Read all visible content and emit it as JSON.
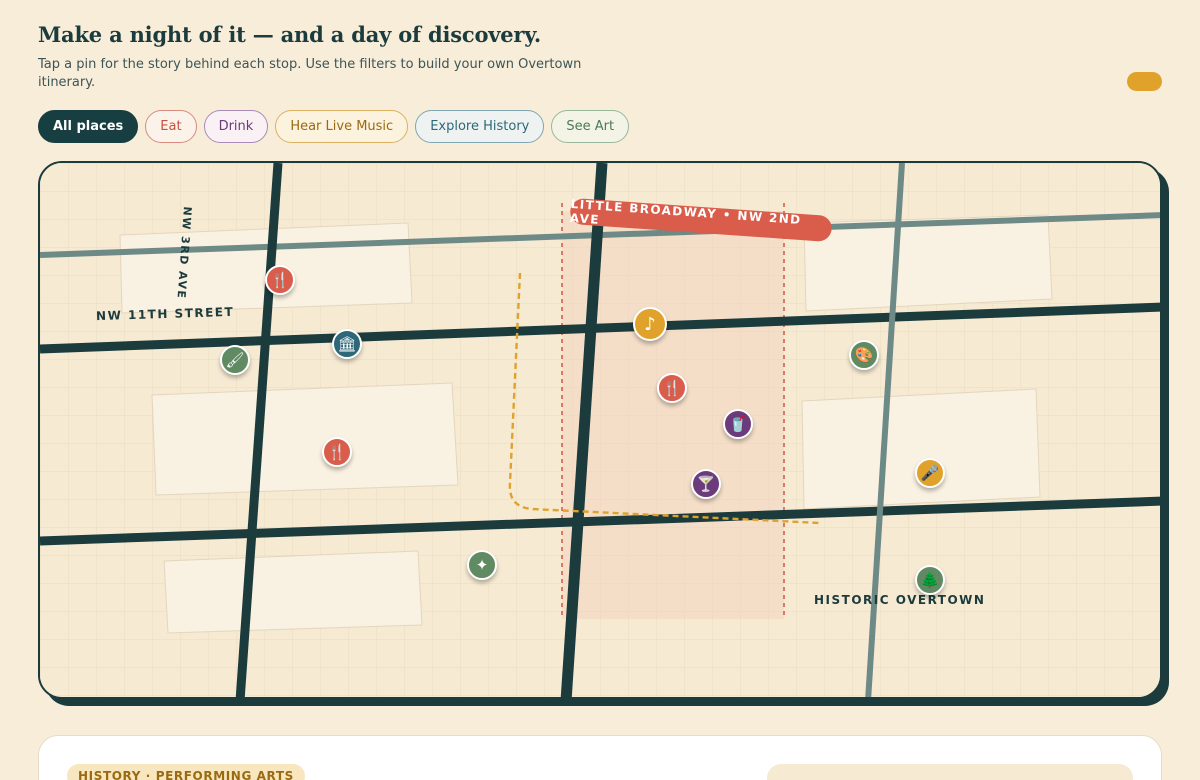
{
  "header": {
    "title": "Make a night of it — and a day of discovery.",
    "subtitle": "Tap a pin for the story behind each stop. Use the filters to build your own Overtown itinerary."
  },
  "filters": [
    {
      "label": "All places",
      "kind": "all",
      "active": true
    },
    {
      "label": "Eat",
      "kind": "eat"
    },
    {
      "label": "Drink",
      "kind": "drink"
    },
    {
      "label": "Hear Live Music",
      "kind": "music"
    },
    {
      "label": "Explore History",
      "kind": "history"
    },
    {
      "label": "See Art",
      "kind": "art"
    }
  ],
  "map": {
    "labels": {
      "nw11th": "NW 11TH STREET",
      "nw3rd": "NW 3RD AVE",
      "little_broadway": "LITTLE BROADWAY • NW 2ND AVE",
      "historic": "HISTORIC OVERTOWN"
    },
    "pins": [
      {
        "category": "eat",
        "icon": "fork-knife-icon"
      },
      {
        "category": "art",
        "icon": "paintbrush-icon"
      },
      {
        "category": "history",
        "icon": "museum-icon"
      },
      {
        "category": "eat",
        "icon": "fork-knife-icon"
      },
      {
        "category": "music",
        "icon": "music-note-icon"
      },
      {
        "category": "eat",
        "icon": "fork-knife-icon"
      },
      {
        "category": "drink",
        "icon": "glass-icon"
      },
      {
        "category": "drink",
        "icon": "cocktail-icon"
      },
      {
        "category": "art",
        "icon": "sparkle-icon"
      },
      {
        "category": "art",
        "icon": "palette-icon"
      },
      {
        "category": "music",
        "icon": "microphone-icon"
      },
      {
        "category": "art",
        "icon": "tree-icon"
      }
    ],
    "colors": {
      "eat": "#d95d4a",
      "drink": "#6b3b7c",
      "music": "#e0a22b",
      "history": "#2e6878",
      "art": "#5f8a62",
      "road": "#1c3b3d"
    }
  },
  "card": {
    "tag": "HISTORY · PERFORMING ARTS"
  }
}
